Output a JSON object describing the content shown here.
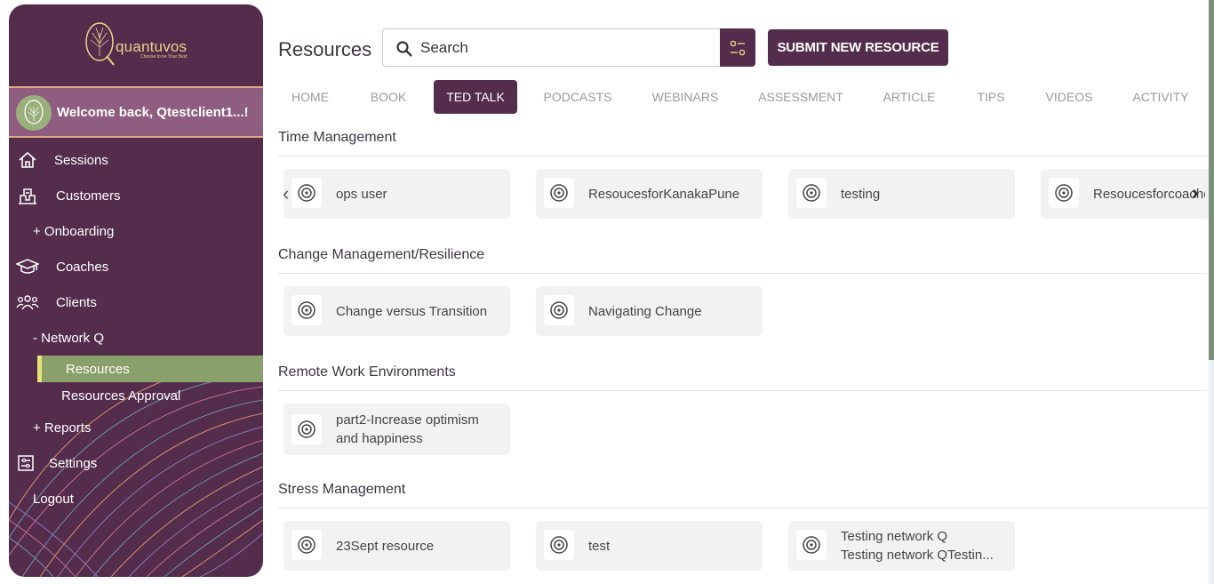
{
  "brand": {
    "name": "quantuvos",
    "tagline": "Choose to be Your Best"
  },
  "user": {
    "welcome": "Welcome back, Qtestclient1...!"
  },
  "nav": {
    "sessions": "Sessions",
    "customers": "Customers",
    "onboarding": "+ Onboarding",
    "coaches": "Coaches",
    "clients": "Clients",
    "network": "- Network Q",
    "resources": "Resources",
    "resources_approval": "Resources Approval",
    "reports": "+ Reports",
    "settings": "Settings",
    "logout": "Logout"
  },
  "header": {
    "title": "Resources",
    "search_placeholder": "Search",
    "submit_label": "SUBMIT NEW RESOURCE"
  },
  "tabs": [
    "HOME",
    "BOOK",
    "TED TALK",
    "PODCASTS",
    "WEBINARS",
    "ASSESSMENT",
    "ARTICLE",
    "TIPS",
    "VIDEOS",
    "ACTIVITY"
  ],
  "active_tab": "TED TALK",
  "sections": [
    {
      "title": "Time Management",
      "cards": [
        "ops user",
        "ResoucesforKanakaPune",
        "testing",
        "Resoucesforcoaches"
      ]
    },
    {
      "title": "Change Management/Resilience",
      "cards": [
        "Change versus Transition",
        "Navigating Change"
      ]
    },
    {
      "title": "Remote Work Environments",
      "cards": [
        "part2-Increase optimism\nand happiness"
      ]
    },
    {
      "title": "Stress Management",
      "cards": [
        "23Sept resource",
        "test",
        "Testing network Q\nTesting network QTestin..."
      ]
    }
  ],
  "colors": {
    "primary": "#542c4c",
    "accent_active": "#8aa06a",
    "accent_bar": "#e8e07a",
    "welcome_bg": "#8f5d80"
  },
  "icons": {
    "card": "podcast-icon",
    "search": "search-icon",
    "filter": "filter-sliders-icon"
  }
}
